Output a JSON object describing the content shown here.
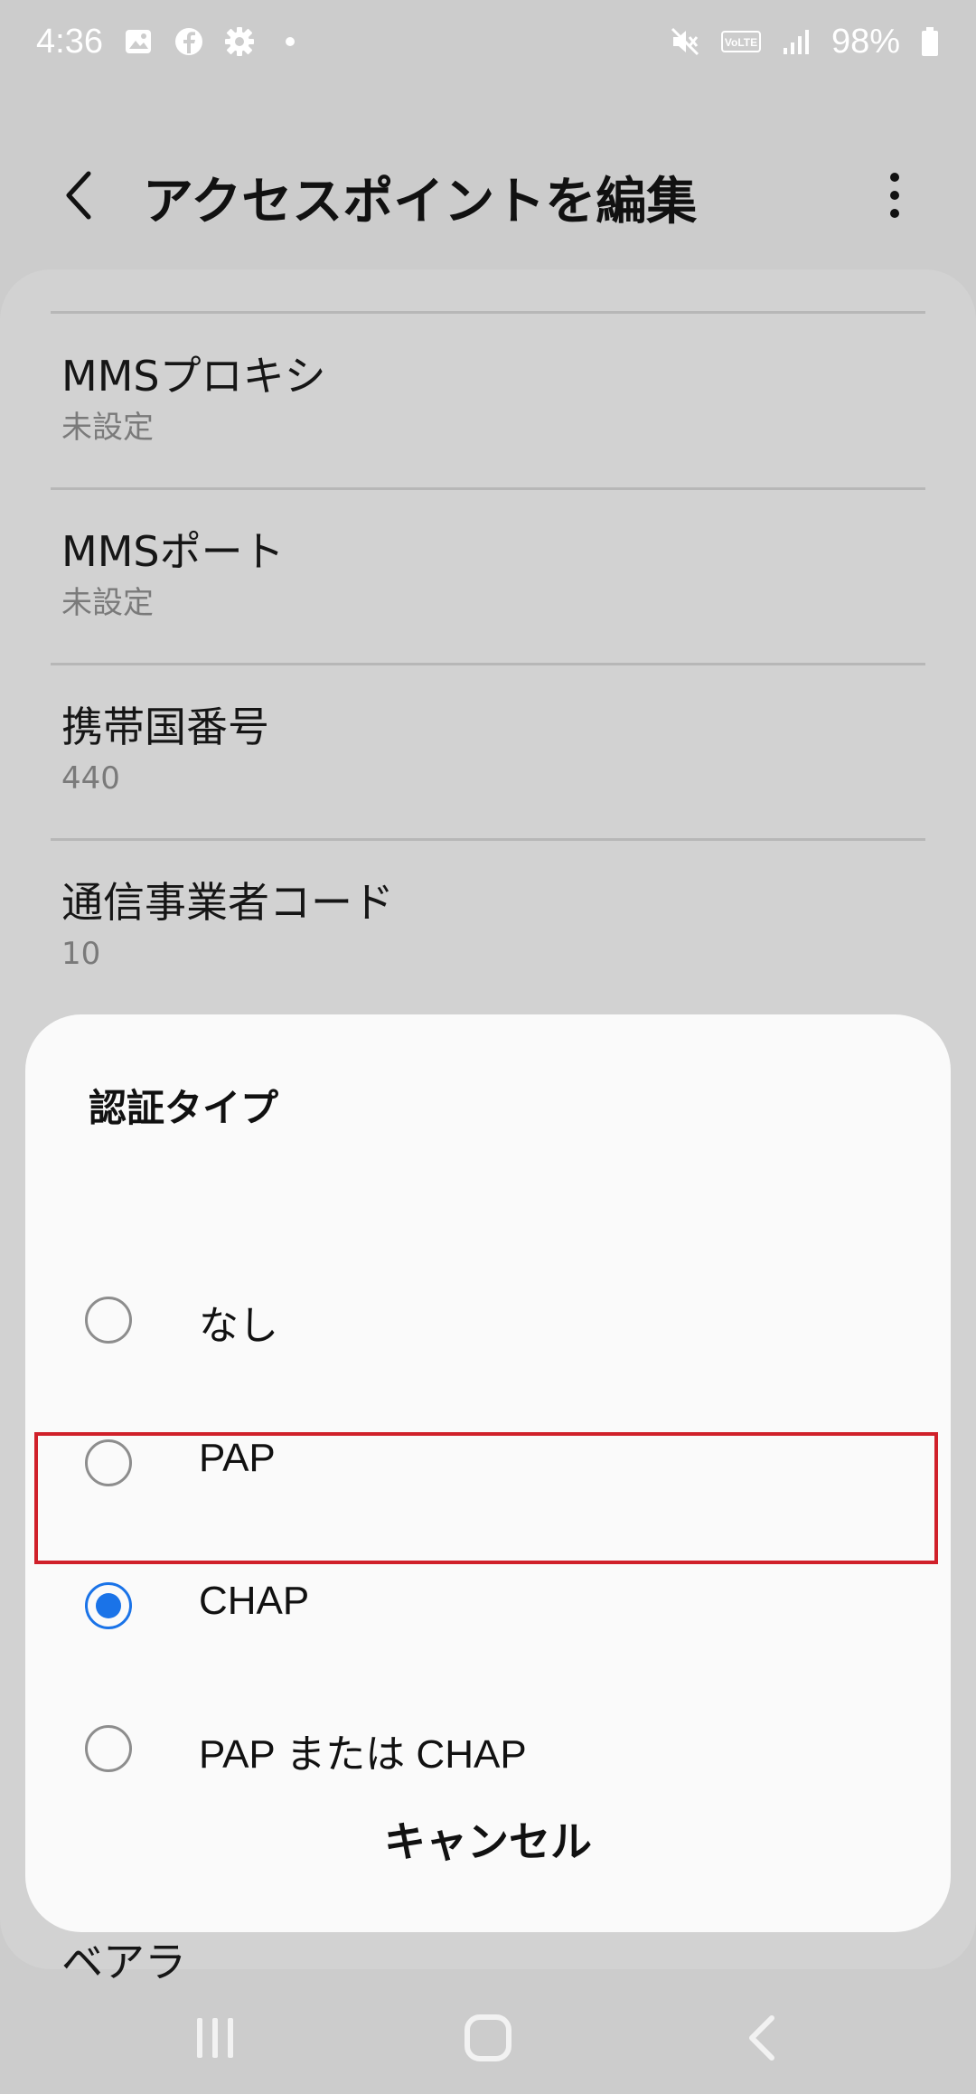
{
  "status_bar": {
    "time": "4:36",
    "battery": "98%",
    "icons": [
      "gallery-icon",
      "facebook-icon",
      "settings-icon",
      "notification-dot-icon",
      "mute-icon",
      "volte-icon",
      "signal-icon",
      "battery-icon"
    ]
  },
  "app_bar": {
    "title": "アクセスポイントを編集",
    "back_icon": "back-arrow-icon",
    "more_icon": "more-vertical-icon"
  },
  "settings": {
    "items": [
      {
        "label": "MMSプロキシ",
        "value": "未設定"
      },
      {
        "label": "MMSポート",
        "value": "未設定"
      },
      {
        "label": "携帯国番号",
        "value": "440"
      },
      {
        "label": "通信事業者コード",
        "value": "10"
      }
    ],
    "bottom_item_label": "ベアラ"
  },
  "dialog": {
    "title": "認証タイプ",
    "options": [
      {
        "label": "なし",
        "selected": false
      },
      {
        "label": "PAP",
        "selected": false
      },
      {
        "label": "CHAP",
        "selected": true
      },
      {
        "label": "PAP または CHAP",
        "selected": false
      }
    ],
    "cancel_label": "キャンセル"
  },
  "colors": {
    "accent": "#1a73e8",
    "highlight": "#d0202a",
    "background": "#cccccc",
    "dialog": "#fafafa"
  },
  "nav_bar": {
    "icons": [
      "recents-icon",
      "home-icon",
      "back-icon"
    ]
  }
}
